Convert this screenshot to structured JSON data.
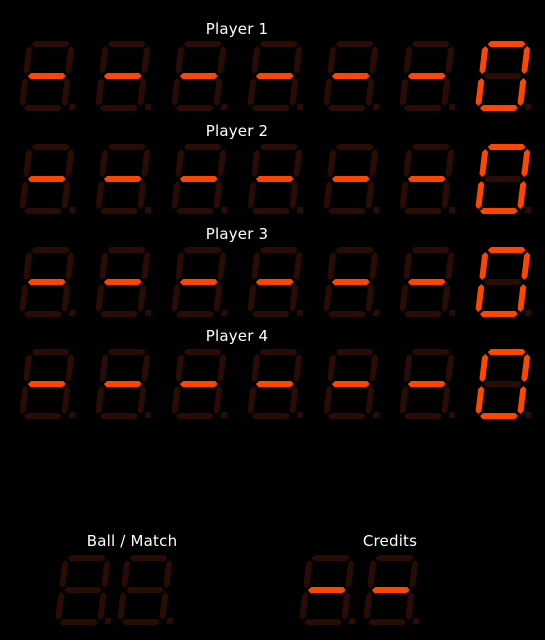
{
  "colors": {
    "background": "#000000",
    "segment_on": "#ff4500",
    "segment_off": "#2a0c04",
    "label_text": "#ffffff"
  },
  "players": [
    {
      "label": "Player 1",
      "digits": [
        "-",
        "-",
        "-",
        "-",
        "-",
        "-",
        "0"
      ]
    },
    {
      "label": "Player 2",
      "digits": [
        "-",
        "-",
        "-",
        "-",
        "-",
        "-",
        "0"
      ]
    },
    {
      "label": "Player 3",
      "digits": [
        "-",
        "-",
        "-",
        "-",
        "-",
        "-",
        "0"
      ]
    },
    {
      "label": "Player 4",
      "digits": [
        "-",
        "-",
        "-",
        "-",
        "-",
        "-",
        "0"
      ]
    }
  ],
  "ball_match": {
    "label": "Ball / Match",
    "digits": [
      "",
      ""
    ]
  },
  "credits": {
    "label": "Credits",
    "digits": [
      "-",
      "-"
    ]
  }
}
